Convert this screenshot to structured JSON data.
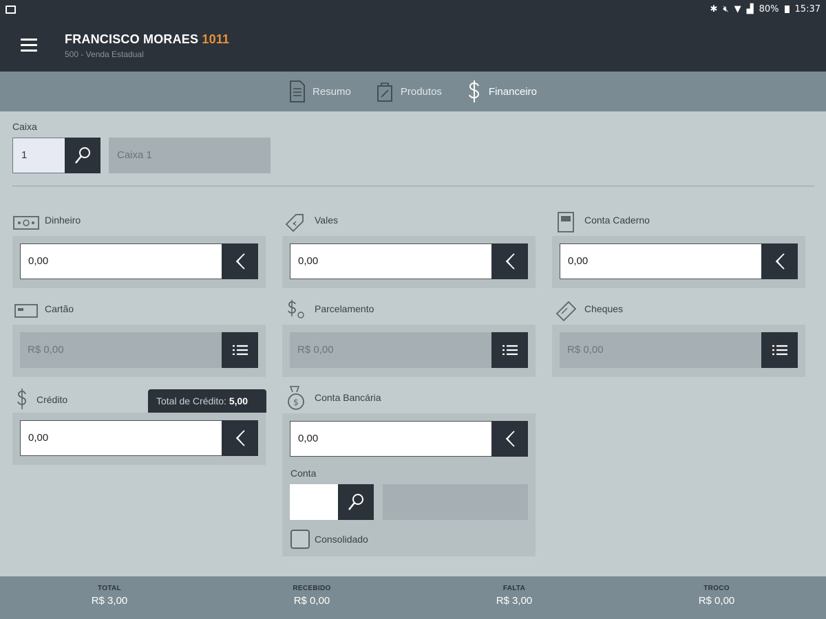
{
  "status_bar": {
    "battery": "80%",
    "time": "15:37"
  },
  "header": {
    "name": "FRANCISCO MORAES",
    "code": "1011",
    "subtitle": "500 - Venda Estadual"
  },
  "tabs": [
    {
      "label": "Resumo",
      "icon": "document-icon"
    },
    {
      "label": "Produtos",
      "icon": "bag-icon"
    },
    {
      "label": "Financeiro",
      "icon": "dollar-icon",
      "active": true
    }
  ],
  "caixa": {
    "label": "Caixa",
    "value": "1",
    "name": "Caixa 1"
  },
  "payments": {
    "dinheiro": {
      "label": "Dinheiro",
      "value": "0,00"
    },
    "vales": {
      "label": "Vales",
      "value": "0,00"
    },
    "conta_caderno": {
      "label": "Conta Caderno",
      "value": "0,00"
    },
    "cartao": {
      "label": "Cartão",
      "value": "R$ 0,00"
    },
    "parcelamento": {
      "label": "Parcelamento",
      "value": "R$ 0,00"
    },
    "cheques": {
      "label": "Cheques",
      "value": "R$ 0,00"
    },
    "credito": {
      "label": "Crédito",
      "value": "0,00",
      "tooltip_label": "Total de Crédito:",
      "tooltip_value": "5,00"
    },
    "conta_bancaria": {
      "label": "Conta Bancária",
      "value": "0,00",
      "conta_label": "Conta",
      "consolidado_label": "Consolidado"
    }
  },
  "footer": [
    {
      "label": "TOTAL",
      "value": "R$ 3,00"
    },
    {
      "label": "RECEBIDO",
      "value": "R$ 0,00"
    },
    {
      "label": "FALTA",
      "value": "R$ 3,00"
    },
    {
      "label": "TROCO",
      "value": "R$ 0,00"
    }
  ],
  "colors": {
    "dark": "#2c323a",
    "accent": "#e8913a",
    "tab_bar": "#7a8b93",
    "background": "#c2cbce"
  }
}
